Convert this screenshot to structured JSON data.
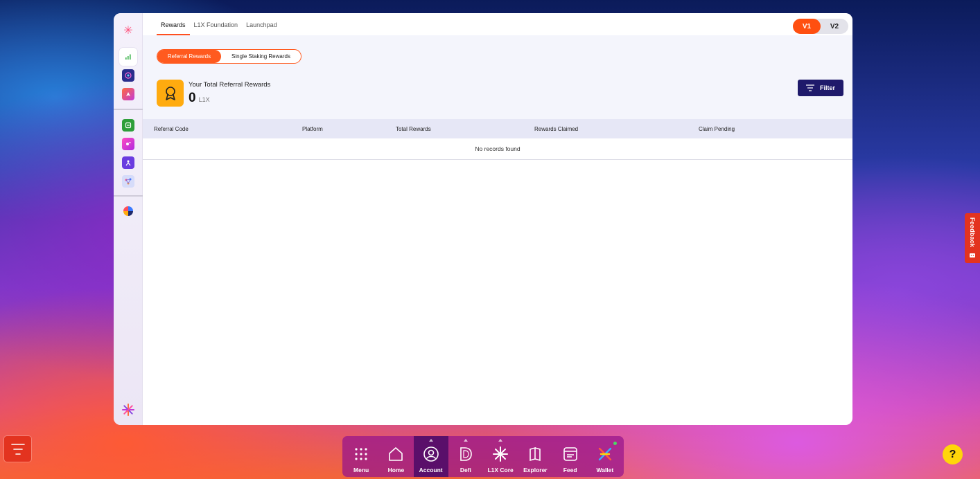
{
  "top_tabs": [
    {
      "label": "Rewards",
      "active": true
    },
    {
      "label": "L1X Foundation",
      "active": false
    },
    {
      "label": "Launchpad",
      "active": false
    }
  ],
  "version_toggle": {
    "v1": "V1",
    "v2": "V2",
    "selected": "V1"
  },
  "reward_type_tabs": {
    "referral": "Referral Rewards",
    "staking": "Single Staking Rewards",
    "selected": "Referral Rewards"
  },
  "summary": {
    "label": "Your Total Referral Rewards",
    "value": "0",
    "unit": "L1X"
  },
  "filter": {
    "label": "Filter"
  },
  "table": {
    "columns": [
      "Referral Code",
      "Platform",
      "Total Rewards",
      "Rewards Claimed",
      "Claim Pending"
    ],
    "empty_text": "No records found"
  },
  "feedback": {
    "label": "Feedback"
  },
  "help": {
    "label": "?"
  },
  "dock": {
    "items": [
      {
        "label": "Menu",
        "icon": "grid-icon"
      },
      {
        "label": "Home",
        "icon": "home-icon"
      },
      {
        "label": "Account",
        "icon": "account-icon"
      },
      {
        "label": "Defi",
        "icon": "defi-icon"
      },
      {
        "label": "L1X Core",
        "icon": "l1x-core-icon"
      },
      {
        "label": "Explorer",
        "icon": "explorer-icon"
      },
      {
        "label": "Feed",
        "icon": "feed-icon"
      },
      {
        "label": "Wallet",
        "icon": "wallet-icon"
      }
    ]
  },
  "colors": {
    "accent": "#ff5a1f",
    "brand_navy": "#1f1a6b",
    "reward_gold": "#ffab0f"
  }
}
